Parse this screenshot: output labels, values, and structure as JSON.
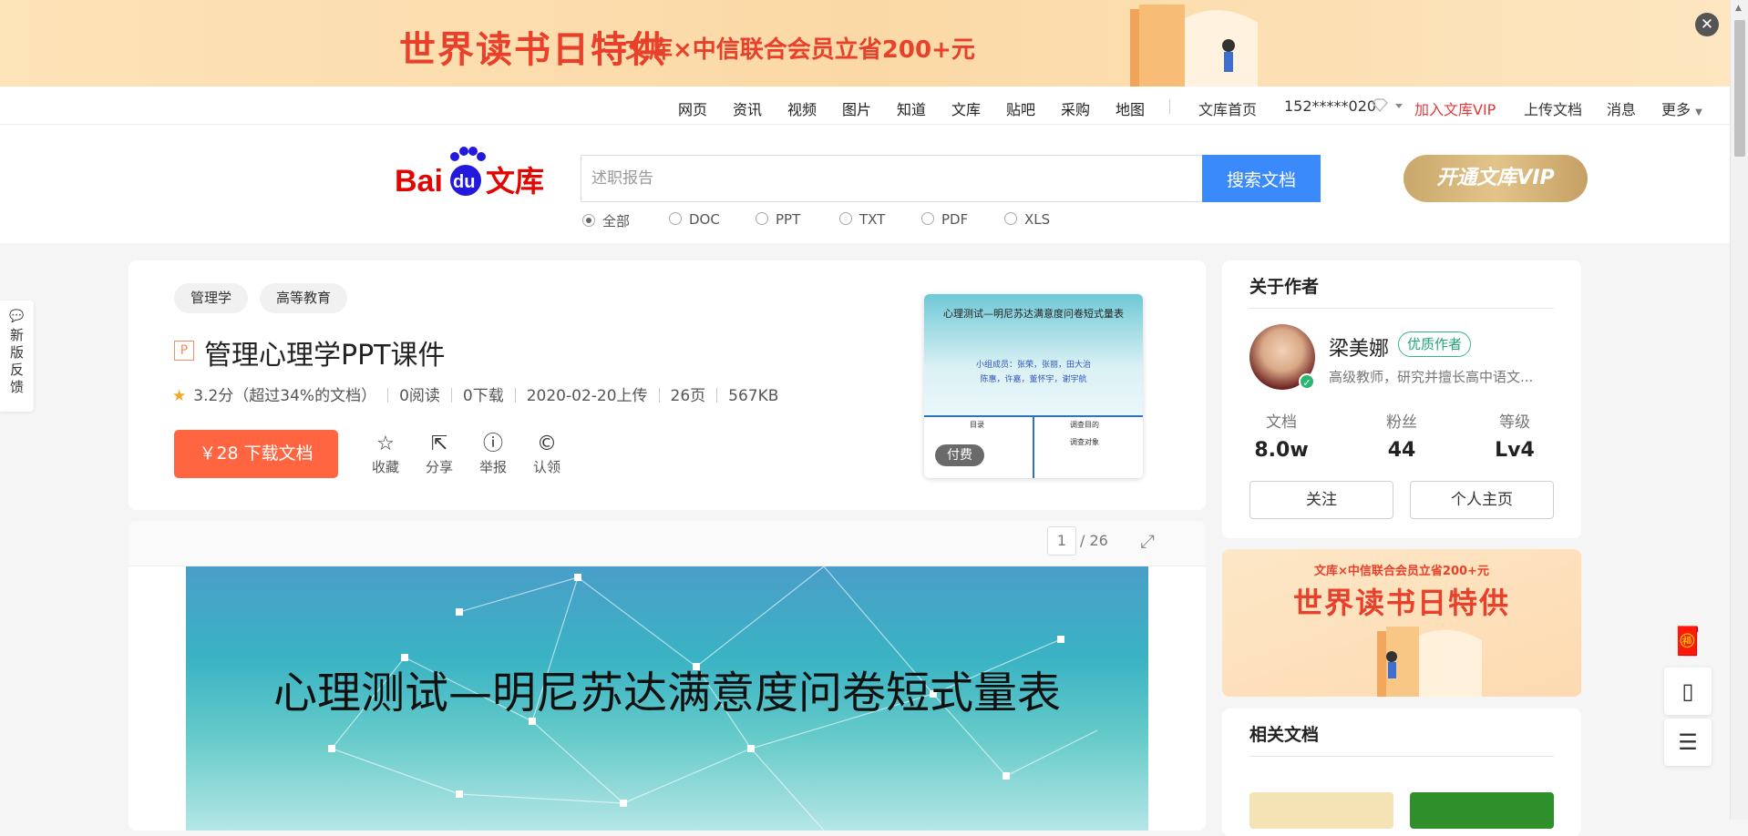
{
  "banner": {
    "title": "世界读书日特供",
    "subtitle": "文库×中信联合会员立省200+元",
    "close_label": "✕"
  },
  "nav": {
    "links": [
      "网页",
      "资讯",
      "视频",
      "图片",
      "知道",
      "文库",
      "贴吧",
      "采购",
      "地图"
    ],
    "home": "文库首页",
    "user": "152*****020",
    "join_vip": "加入文库VIP",
    "upload": "上传文档",
    "messages": "消息",
    "more": "更多"
  },
  "search": {
    "logo_bai": "Bai",
    "logo_du": "du",
    "logo_wenku": "文库",
    "placeholder": "述职报告",
    "button": "搜索文档",
    "filters": [
      "全部",
      "DOC",
      "PPT",
      "TXT",
      "PDF",
      "XLS"
    ],
    "selected_filter": "全部",
    "vip_button": "开通文库VIP"
  },
  "feedback": {
    "label": "新版反馈"
  },
  "doc": {
    "tags": [
      "管理学",
      "高等教育"
    ],
    "type_icon": "P",
    "title": "管理心理学PPT课件",
    "rating": "3.2分（超过34%的文档）",
    "reads": "0阅读",
    "downloads": "0下载",
    "upload_date": "2020-02-20上传",
    "pages": "26页",
    "size": "567KB",
    "download_button": "￥28 下载文档",
    "actions": [
      {
        "label": "收藏",
        "icon": "star-outline-icon"
      },
      {
        "label": "分享",
        "icon": "share-icon"
      },
      {
        "label": "举报",
        "icon": "report-icon"
      },
      {
        "label": "认领",
        "icon": "copyright-icon"
      }
    ],
    "thumb": {
      "title": "心理测试—明尼苏达满意度问卷短式量表",
      "line1": "小组成员：张荣，张丽，田大治",
      "line2": "陈惠，许嘉，董怀宇，谢宇航",
      "pay_badge": "付费",
      "left_heading": "目录",
      "right_heading": "调查目的",
      "right_sub": "调查对象"
    }
  },
  "viewer": {
    "current_page": "1",
    "total_pages": "/ 26",
    "slide_title": "心理测试—明尼苏达满意度问卷短式量表"
  },
  "author": {
    "section_title": "关于作者",
    "name": "梁美娜",
    "badge": "优质作者",
    "description": "高级教师，研究并擅长高中语文...",
    "stats": [
      {
        "label": "文档",
        "value": "8.0w"
      },
      {
        "label": "粉丝",
        "value": "44"
      },
      {
        "label": "等级",
        "value": "Lv4"
      }
    ],
    "follow_button": "关注",
    "homepage_button": "个人主页"
  },
  "side_promo": {
    "line1": "文库×中信联合会员立省200+元",
    "line2": "世界读书日特供"
  },
  "related": {
    "section_title": "相关文档"
  },
  "colors": {
    "accent_blue": "#3a8afb",
    "download_orange": "#ff6540",
    "vip_red": "#e4393c",
    "quality_green": "#1fa678"
  }
}
